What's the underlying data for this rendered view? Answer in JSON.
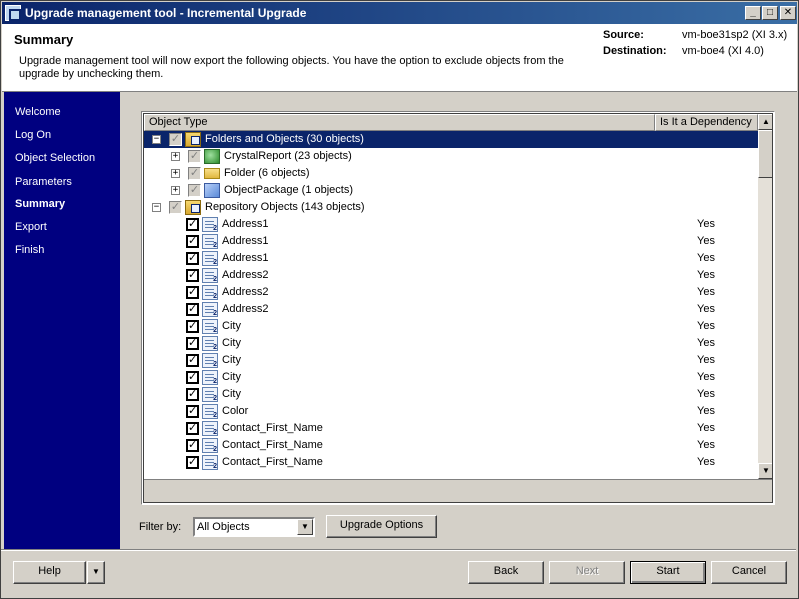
{
  "window": {
    "title": "Upgrade management tool - Incremental Upgrade",
    "controls": {
      "minimize": "_",
      "maximize": "□",
      "close": "✕"
    }
  },
  "header": {
    "title": "Summary",
    "description": "Upgrade management tool will now export the following objects. You have the option to exclude objects from the upgrade by unchecking them.",
    "source_label": "Source:",
    "source_value": "vm-boe31sp2 (XI 3.x)",
    "destination_label": "Destination:",
    "destination_value": "vm-boe4 (XI 4.0)"
  },
  "nav": {
    "items": [
      {
        "label": "Welcome"
      },
      {
        "label": "Log On"
      },
      {
        "label": "Object Selection"
      },
      {
        "label": "Parameters"
      },
      {
        "label": "Summary",
        "active": true
      },
      {
        "label": "Export"
      },
      {
        "label": "Finish"
      }
    ]
  },
  "list": {
    "columns": [
      "Object Type",
      "Is It a Dependency"
    ],
    "rows": [
      {
        "label": "Folders and Objects (30 objects)",
        "dependency": "",
        "level": 0,
        "expander": "−",
        "check": "partial",
        "icon": "folder-objects-icon",
        "selected": true
      },
      {
        "label": "CrystalReport (23 objects)",
        "dependency": "",
        "level": 1,
        "expander": "+",
        "check": "partial",
        "icon": "crystal-report-icon"
      },
      {
        "label": "Folder (6 objects)",
        "dependency": "",
        "level": 1,
        "expander": "+",
        "check": "partial",
        "icon": "folder-icon"
      },
      {
        "label": "ObjectPackage (1 objects)",
        "dependency": "",
        "level": 1,
        "expander": "+",
        "check": "partial",
        "icon": "object-package-icon"
      },
      {
        "label": "Repository Objects (143 objects)",
        "dependency": "",
        "level": 0,
        "expander": "−",
        "check": "partial",
        "icon": "folder-objects-icon"
      },
      {
        "label": "Address1",
        "dependency": "Yes",
        "level": 2,
        "check": "full",
        "icon": "repository-object-icon"
      },
      {
        "label": "Address1",
        "dependency": "Yes",
        "level": 2,
        "check": "full",
        "icon": "repository-object-icon"
      },
      {
        "label": "Address1",
        "dependency": "Yes",
        "level": 2,
        "check": "full",
        "icon": "repository-object-icon"
      },
      {
        "label": "Address2",
        "dependency": "Yes",
        "level": 2,
        "check": "full",
        "icon": "repository-object-icon"
      },
      {
        "label": "Address2",
        "dependency": "Yes",
        "level": 2,
        "check": "full",
        "icon": "repository-object-icon"
      },
      {
        "label": "Address2",
        "dependency": "Yes",
        "level": 2,
        "check": "full",
        "icon": "repository-object-icon"
      },
      {
        "label": "City",
        "dependency": "Yes",
        "level": 2,
        "check": "full",
        "icon": "repository-object-icon"
      },
      {
        "label": "City",
        "dependency": "Yes",
        "level": 2,
        "check": "full",
        "icon": "repository-object-icon"
      },
      {
        "label": "City",
        "dependency": "Yes",
        "level": 2,
        "check": "full",
        "icon": "repository-object-icon"
      },
      {
        "label": "City",
        "dependency": "Yes",
        "level": 2,
        "check": "full",
        "icon": "repository-object-icon"
      },
      {
        "label": "City",
        "dependency": "Yes",
        "level": 2,
        "check": "full",
        "icon": "repository-object-icon"
      },
      {
        "label": "Color",
        "dependency": "Yes",
        "level": 2,
        "check": "full",
        "icon": "repository-object-icon"
      },
      {
        "label": "Contact_First_Name",
        "dependency": "Yes",
        "level": 2,
        "check": "full",
        "icon": "repository-object-icon"
      },
      {
        "label": "Contact_First_Name",
        "dependency": "Yes",
        "level": 2,
        "check": "full",
        "icon": "repository-object-icon"
      },
      {
        "label": "Contact_First_Name",
        "dependency": "Yes",
        "level": 2,
        "check": "full",
        "icon": "repository-object-icon"
      }
    ]
  },
  "filter": {
    "label": "Filter by:",
    "selected": "All Objects",
    "upgrade_options_label": "Upgrade Options"
  },
  "footer": {
    "help_label": "Help",
    "back_label": "Back",
    "next_label": "Next",
    "start_label": "Start",
    "cancel_label": "Cancel"
  }
}
